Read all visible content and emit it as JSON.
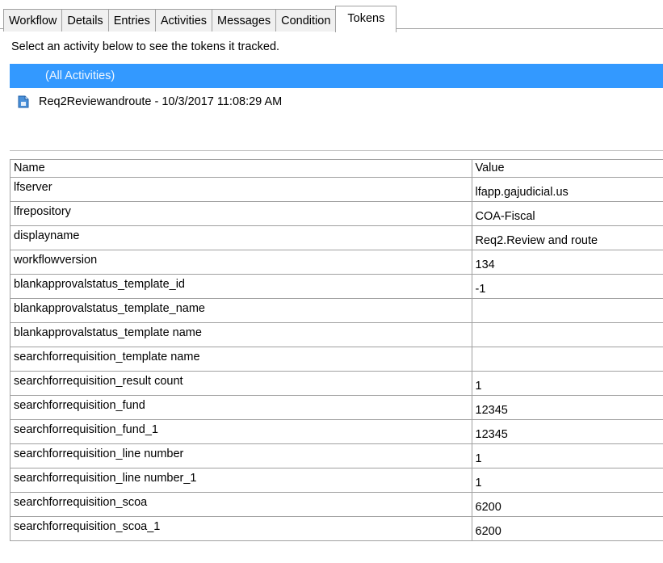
{
  "tabs": [
    {
      "label": "Workflow",
      "active": false
    },
    {
      "label": "Details",
      "active": false
    },
    {
      "label": "Entries",
      "active": false
    },
    {
      "label": "Activities",
      "active": false
    },
    {
      "label": "Messages",
      "active": false
    },
    {
      "label": "Condition",
      "active": false
    },
    {
      "label": "Tokens",
      "active": true
    }
  ],
  "instructions": "Select an activity below to see the tokens it tracked.",
  "activities": {
    "all_label": "(All Activities)",
    "items": [
      {
        "label": "Req2Reviewandroute - 10/3/2017 11:08:29 AM",
        "icon": "activity-icon"
      }
    ]
  },
  "grid": {
    "columns": [
      "Name",
      "Value"
    ],
    "rows": [
      {
        "name": "lfserver",
        "value": "lfapp.gajudicial.us"
      },
      {
        "name": "lfrepository",
        "value": "COA-Fiscal"
      },
      {
        "name": "displayname",
        "value": "Req2.Review and route"
      },
      {
        "name": "workflowversion",
        "value": "134"
      },
      {
        "name": "blankapprovalstatus_template_id",
        "value": "-1"
      },
      {
        "name": "blankapprovalstatus_template_name",
        "value": ""
      },
      {
        "name": "blankapprovalstatus_template name",
        "value": ""
      },
      {
        "name": "searchforrequisition_template name",
        "value": ""
      },
      {
        "name": "searchforrequisition_result count",
        "value": "1"
      },
      {
        "name": "searchforrequisition_fund",
        "value": "12345"
      },
      {
        "name": "searchforrequisition_fund_1",
        "value": "12345"
      },
      {
        "name": "searchforrequisition_line number",
        "value": "1"
      },
      {
        "name": "searchforrequisition_line number_1",
        "value": "1"
      },
      {
        "name": "searchforrequisition_scoa",
        "value": "6200"
      },
      {
        "name": "searchforrequisition_scoa_1",
        "value": "6200"
      }
    ]
  },
  "colors": {
    "selection": "#3399ff",
    "border": "#a0a0a0",
    "tab_bg": "#f0f0f0"
  }
}
